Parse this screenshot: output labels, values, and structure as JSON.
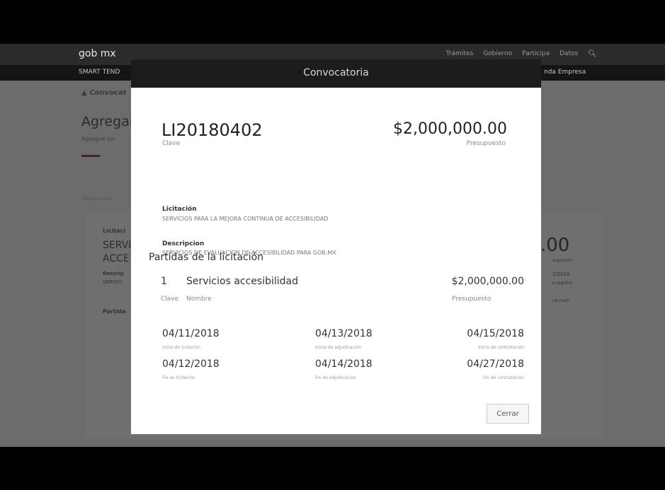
{
  "background": {
    "brand": "gob mx",
    "nav": [
      "Trámites",
      "Gobierno",
      "Participa",
      "Datos"
    ],
    "subbar_left": "SMART TEND",
    "subbar_right": "nda Empresa",
    "breadcrumb": "Convocat",
    "title": "Agregar",
    "subtitle": "Agregue los",
    "filter_text": "Todas las conv",
    "card": {
      "licitacion_label": "Licitaci",
      "title_line1": "SERVI",
      "title_line2": "ACCE",
      "descripcion_label": "Descrip",
      "descripcion_value": "SERVICI",
      "partidas_label": "Partida",
      "amount": ".00",
      "amount_label": "supuesto",
      "date": "2/2018",
      "date_label": "e registro",
      "hash_label": "rie hash"
    }
  },
  "modal": {
    "title": "Convocatoria",
    "clave_code": "LI20180402",
    "clave_label": "Clave",
    "budget_amount": "$2,000,000.00",
    "budget_label": "Presupuesto",
    "licitacion_label": "Licitación",
    "licitacion_value": "SERVICIOS PARA LA MEJORA CONTINUA DE ACCESIBILIDAD",
    "descripcion_label": "Descripcion",
    "descripcion_value": "SERVICIOS DE EVALUACION DE ACCESIBILIDAD PARA GOB.MX",
    "partidas_heading": "Partidas de la licitación",
    "partida": {
      "number": "1",
      "name": "Servicios accesibilidad",
      "amount": "$2,000,000.00",
      "clave_label": "Clave",
      "nombre_label": "Nombre",
      "presupuesto_label": "Presupuesto"
    },
    "dates": {
      "inicio_licitacion": "04/11/2018",
      "inicio_licitacion_label": "Inicio de licitación",
      "inicio_adjudicacion": "04/13/2018",
      "inicio_adjudicacion_label": "Inicio de adjudicación",
      "inicio_contratacion": "04/15/2018",
      "inicio_contratacion_label": "Inicio de contratación",
      "fin_licitacion": "04/12/2018",
      "fin_licitacion_label": "Fin de licitación",
      "fin_adjudicacion": "04/14/2018",
      "fin_adjudicacion_label": "Fin de adjudicación",
      "fin_contratacion": "04/27/2018",
      "fin_contratacion_label": "Fin de contratación"
    },
    "close_label": "Cerrar"
  }
}
